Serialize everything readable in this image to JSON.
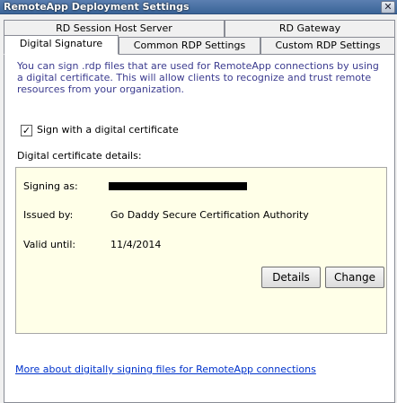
{
  "window": {
    "title": "RemoteApp Deployment Settings",
    "close_glyph": "✕"
  },
  "tabs": {
    "back_row": [
      {
        "label": "RD Session Host Server"
      },
      {
        "label": "RD Gateway"
      }
    ],
    "front_row": [
      {
        "label": "Digital Signature",
        "active": true
      },
      {
        "label": "Common RDP Settings"
      },
      {
        "label": "Custom RDP Settings"
      }
    ]
  },
  "panel": {
    "intro_text": "You can sign .rdp files that are used for RemoteApp connections by using a digital certificate. This will allow clients to recognize and trust remote resources from your organization.",
    "checkbox": {
      "label": "Sign with a digital certificate",
      "checked": true,
      "glyph": "✓"
    },
    "details_label": "Digital certificate details:",
    "details": {
      "signing_as_label": "Signing as:",
      "issued_by_label": "Issued by:",
      "issued_by_value": "Go Daddy Secure Certification Authority",
      "valid_until_label": "Valid until:",
      "valid_until_value": "11/4/2014"
    },
    "buttons": {
      "details": "Details",
      "change": "Change"
    },
    "link_text": "More about digitally signing files for RemoteApp connections"
  },
  "colors": {
    "intro_text": "#3b3b8f",
    "details_background": "#ffffe8",
    "link": "#0033cc",
    "titlebar": "#3a6497"
  }
}
